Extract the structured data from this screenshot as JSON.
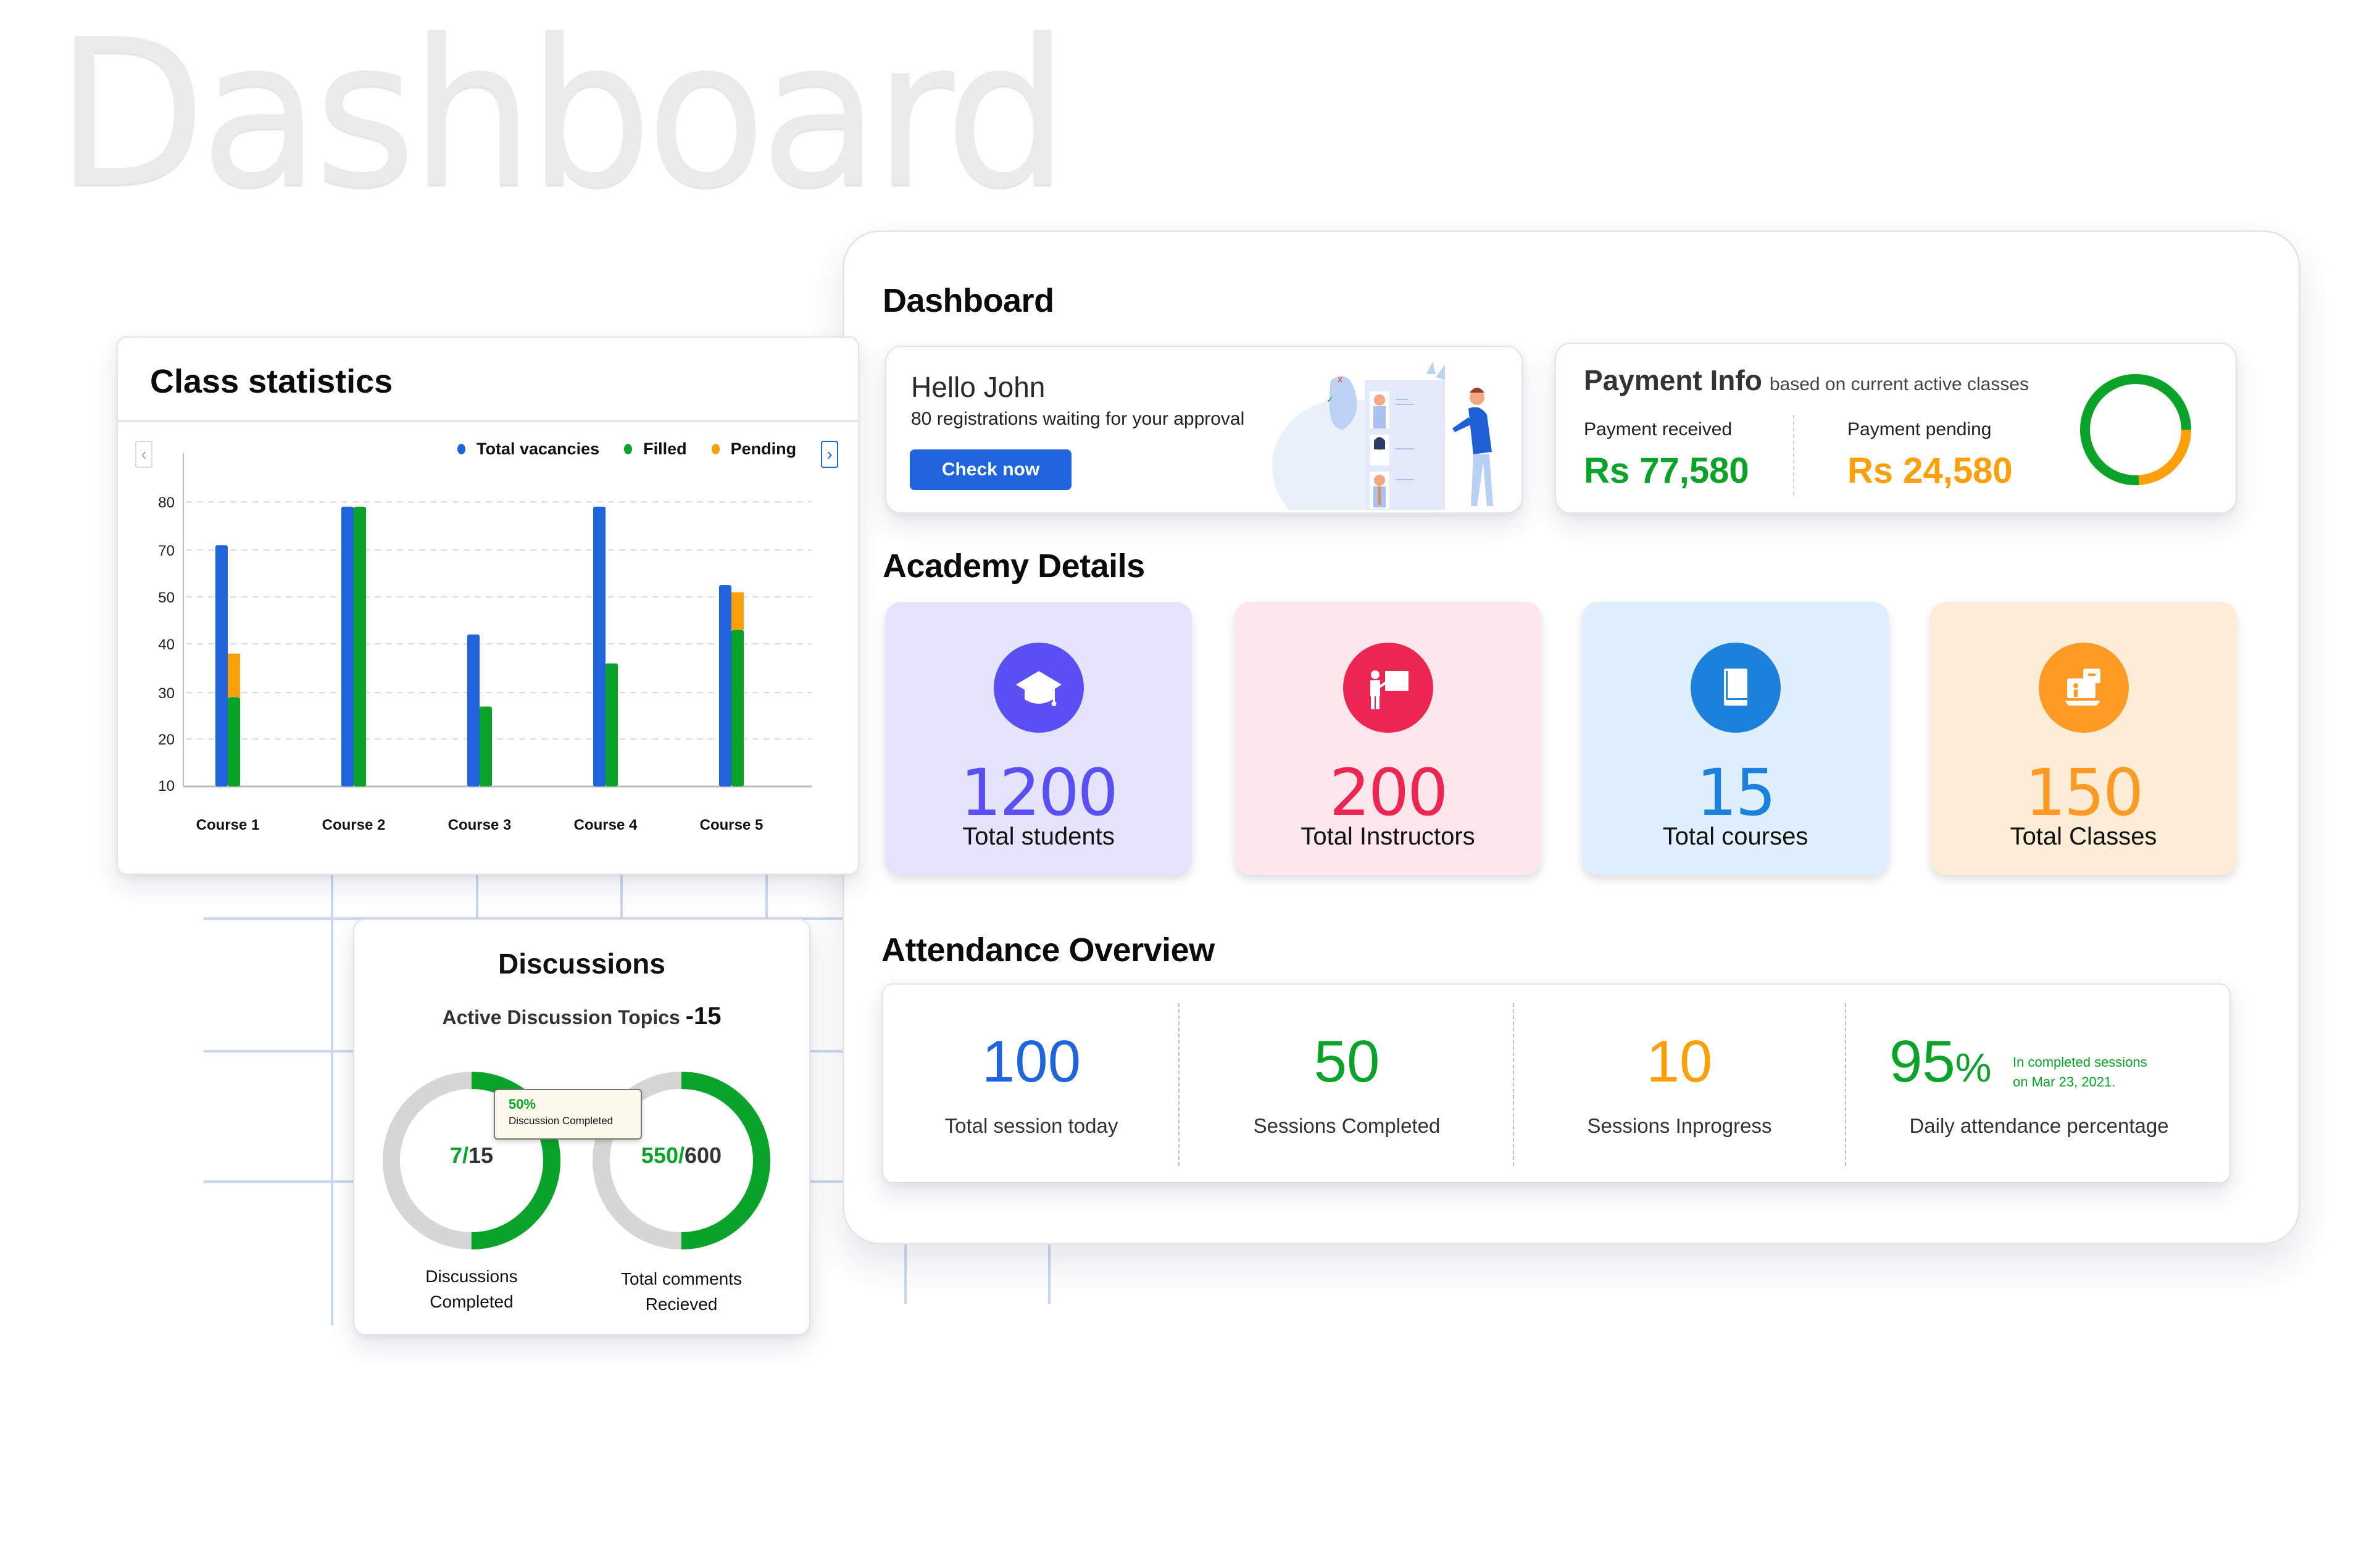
{
  "watermark": "Dashboard",
  "colors": {
    "blue": "#1f63dd",
    "green": "#0aa32a",
    "orange": "#ff9f0a",
    "grey_track": "#d6d6d6",
    "purple": "#5a4ff5",
    "red": "#ec2552",
    "sky": "#1c80dd",
    "amber": "#ff9b24"
  },
  "main": {
    "title": "Dashboard",
    "hello": {
      "title": "Hello John",
      "subtitle": "80 registrations waiting for your approval",
      "button": "Check now"
    },
    "payment": {
      "title": "Payment Info",
      "subtitle": "based on current active classes",
      "received_label": "Payment received",
      "received_value": "Rs 77,580",
      "pending_label": "Payment pending",
      "pending_value": "Rs 24,580",
      "received_share": 0.76
    },
    "academy": {
      "title": "Academy Details",
      "items": [
        {
          "value": "1200",
          "label": "Total  students",
          "icon": "graduation-cap-icon"
        },
        {
          "value": "200",
          "label": "Total Instructors",
          "icon": "teacher-board-icon"
        },
        {
          "value": "15",
          "label": "Total courses",
          "icon": "book-icon"
        },
        {
          "value": "150",
          "label": "Total Classes",
          "icon": "online-class-icon"
        }
      ]
    },
    "attendance": {
      "title": "Attendance Overview",
      "items": [
        {
          "value": "100",
          "label": "Total session today"
        },
        {
          "value": "50",
          "label": "Sessions Completed"
        },
        {
          "value": "10",
          "label": "Sessions Inprogress"
        },
        {
          "value": "95",
          "unit": "%",
          "label": "Daily attendance percentage",
          "note_line1": "In completed sessions",
          "note_line2": "on Mar 23, 2021."
        }
      ]
    }
  },
  "class_stats": {
    "title": "Class statistics",
    "prev_label": "‹",
    "next_label": "›"
  },
  "chart_data": {
    "type": "bar",
    "title": "Class statistics",
    "xlabel": "",
    "ylabel": "",
    "categories": [
      "Course 1",
      "Course 2",
      "Course 3",
      "Course 4",
      "Course 5"
    ],
    "yticks": [
      "80",
      "70",
      "50",
      "40",
      "30",
      "20",
      "10"
    ],
    "series": [
      {
        "name": "Total vacancies",
        "color": "#1f63dd",
        "values": [
          71,
          79,
          42,
          79,
          55
        ]
      },
      {
        "name": "Filled",
        "color": "#0aa32a",
        "values": [
          29,
          79,
          27,
          36,
          43
        ]
      },
      {
        "name": "Pending",
        "color": "#ff9f0a",
        "values": [
          9,
          0,
          0,
          0,
          9
        ]
      }
    ],
    "stacked_pending_on_filled": true,
    "grid": true,
    "legend": "top-right"
  },
  "discussions": {
    "title": "Discussions",
    "subtitle": "Active Discussion Topics",
    "subtitle_count": "-15",
    "rings": [
      {
        "done": "7",
        "total": "15",
        "fraction": 0.5,
        "label_line1": "Discussions",
        "label_line2": "Completed"
      },
      {
        "done": "550",
        "total": "600",
        "fraction": 0.5,
        "label_line1": "Total comments",
        "label_line2": "Recieved"
      }
    ],
    "tooltip": {
      "percent": "50%",
      "text": "Discussion Completed"
    }
  }
}
